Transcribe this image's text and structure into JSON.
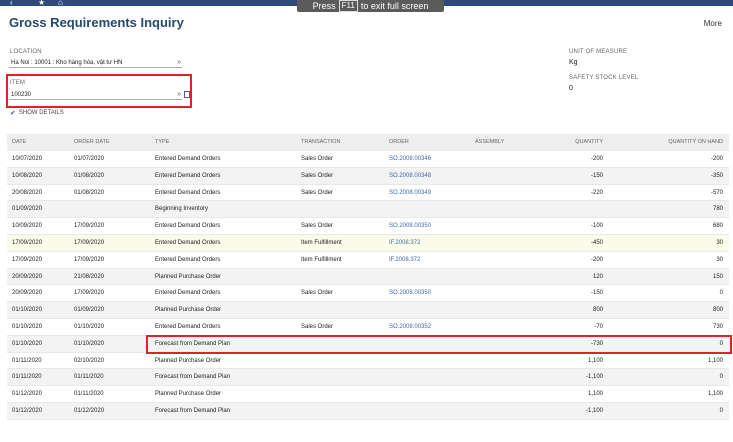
{
  "fullscreen_banner": {
    "prefix": "Press",
    "key": "F11",
    "suffix": "to exit full screen"
  },
  "page": {
    "title": "Gross Requirements Inquiry",
    "more_label": "More"
  },
  "filters": {
    "location": {
      "label": "LOCATION",
      "value": "Ha Noi : 10001 : Kho hàng hóa, vật tư HN"
    },
    "item": {
      "label": "ITEM",
      "value": "100230"
    },
    "show_details": {
      "label": "SHOW DETAILS",
      "checked": true
    },
    "unit_of_measure": {
      "label": "UNIT OF MEASURE",
      "value": "Kg"
    },
    "safety_stock": {
      "label": "SAFETY STOCK LEVEL",
      "value": "0"
    }
  },
  "grid": {
    "columns": [
      "DATE",
      "ORDER DATE",
      "TYPE",
      "TRANSACTION",
      "ORDER",
      "ASSEMBLY",
      "QUANTITY",
      "QUANTITY ON HAND"
    ],
    "rows": [
      {
        "date": "10/07/2020",
        "order_date": "01/07/2020",
        "type": "Entered Demand Orders",
        "transaction": "Sales Order",
        "order": "SO.2008.00346",
        "assembly": "",
        "quantity": "-200",
        "qoh": "-200"
      },
      {
        "date": "10/08/2020",
        "order_date": "01/08/2020",
        "type": "Entered Demand Orders",
        "transaction": "Sales Order",
        "order": "SO.2008.00348",
        "assembly": "",
        "quantity": "-150",
        "qoh": "-350"
      },
      {
        "date": "20/08/2020",
        "order_date": "01/08/2020",
        "type": "Entered Demand Orders",
        "transaction": "Sales Order",
        "order": "SO.2008.00349",
        "assembly": "",
        "quantity": "-220",
        "qoh": "-570"
      },
      {
        "date": "01/09/2020",
        "order_date": "",
        "type": "Beginning Inventory",
        "transaction": "",
        "order": "",
        "assembly": "",
        "quantity": "",
        "qoh": "780"
      },
      {
        "date": "10/09/2020",
        "order_date": "17/09/2020",
        "type": "Entered Demand Orders",
        "transaction": "Sales Order",
        "order": "SO.2008.00350",
        "assembly": "",
        "quantity": "-100",
        "qoh": "680"
      },
      {
        "date": "17/09/2020",
        "order_date": "17/09/2020",
        "type": "Entered Demand Orders",
        "transaction": "Item Fulfillment",
        "order": "IF.2008.372",
        "assembly": "",
        "quantity": "-450",
        "qoh": "30"
      },
      {
        "date": "17/09/2020",
        "order_date": "17/09/2020",
        "type": "Entered Demand Orders",
        "transaction": "Item Fulfillment",
        "order": "IF.2008.372",
        "assembly": "",
        "quantity": "-200",
        "qoh": "30"
      },
      {
        "date": "20/09/2020",
        "order_date": "21/08/2020",
        "type": "Planned Purchase Order",
        "transaction": "",
        "order": "",
        "assembly": "",
        "quantity": "120",
        "qoh": "150"
      },
      {
        "date": "20/09/2020",
        "order_date": "17/09/2020",
        "type": "Entered Demand Orders",
        "transaction": "Sales Order",
        "order": "SO.2008.00350",
        "assembly": "",
        "quantity": "-150",
        "qoh": "0"
      },
      {
        "date": "01/10/2020",
        "order_date": "01/09/2020",
        "type": "Planned Purchase Order",
        "transaction": "",
        "order": "",
        "assembly": "",
        "quantity": "800",
        "qoh": "800"
      },
      {
        "date": "01/10/2020",
        "order_date": "01/10/2020",
        "type": "Entered Demand Orders",
        "transaction": "Sales Order",
        "order": "SO.2008.00352",
        "assembly": "",
        "quantity": "-70",
        "qoh": "730"
      },
      {
        "date": "01/10/2020",
        "order_date": "01/10/2020",
        "type": "Forecast from Demand Plan",
        "transaction": "",
        "order": "",
        "assembly": "",
        "quantity": "-730",
        "qoh": "0"
      },
      {
        "date": "01/11/2020",
        "order_date": "02/10/2020",
        "type": "Planned Purchase Order",
        "transaction": "",
        "order": "",
        "assembly": "",
        "quantity": "1,100",
        "qoh": "1,100"
      },
      {
        "date": "01/11/2020",
        "order_date": "01/11/2020",
        "type": "Forecast from Demand Plan",
        "transaction": "",
        "order": "",
        "assembly": "",
        "quantity": "-1,100",
        "qoh": "0"
      },
      {
        "date": "01/12/2020",
        "order_date": "01/11/2020",
        "type": "Planned Purchase Order",
        "transaction": "",
        "order": "",
        "assembly": "",
        "quantity": "1,100",
        "qoh": "1,100"
      },
      {
        "date": "01/12/2020",
        "order_date": "01/12/2020",
        "type": "Forecast from Demand Plan",
        "transaction": "",
        "order": "",
        "assembly": "",
        "quantity": "-1,100",
        "qoh": "0"
      }
    ]
  },
  "colors": {
    "title": "#25496f",
    "link": "#3d6aa8",
    "highlight_border": "#d6262b",
    "topbar": "#2d4a7c"
  }
}
